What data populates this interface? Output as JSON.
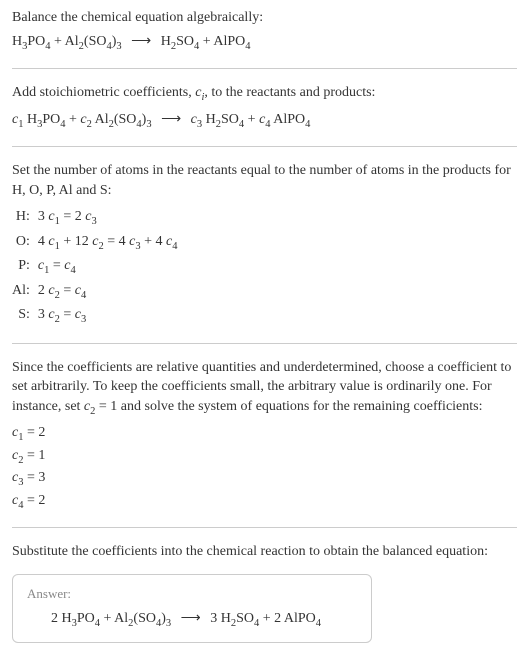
{
  "intro": {
    "line1": "Balance the chemical equation algebraically:",
    "eq_lhs1": "H",
    "eq_lhs1_sub": "3",
    "eq_lhs2": "PO",
    "eq_lhs2_sub": "4",
    "plus1": " + ",
    "eq_lhs3": "Al",
    "eq_lhs3_sub": "2",
    "eq_lhs4": "(SO",
    "eq_lhs4_sub": "4",
    "eq_lhs5": ")",
    "eq_lhs5_sub": "3",
    "arrow": "⟶",
    "eq_rhs1": "H",
    "eq_rhs1_sub": "2",
    "eq_rhs2": "SO",
    "eq_rhs2_sub": "4",
    "plus2": " + ",
    "eq_rhs3": "AlPO",
    "eq_rhs3_sub": "4"
  },
  "stoich": {
    "text": "Add stoichiometric coefficients, ",
    "ci": "c",
    "ci_sub": "i",
    "text2": ", to the reactants and products:",
    "c1": "c",
    "c1_sub": "1",
    "sp1": " H",
    "sp1a": "3",
    "sp1b": "PO",
    "sp1c": "4",
    "plus1": " + ",
    "c2": "c",
    "c2_sub": "2",
    "sp2": " Al",
    "sp2a": "2",
    "sp2b": "(SO",
    "sp2c": "4",
    "sp2d": ")",
    "sp2e": "3",
    "arrow": "⟶",
    "c3": "c",
    "c3_sub": "3",
    "sp3": " H",
    "sp3a": "2",
    "sp3b": "SO",
    "sp3c": "4",
    "plus2": " + ",
    "c4": "c",
    "c4_sub": "4",
    "sp4": " AlPO",
    "sp4a": "4"
  },
  "atoms": {
    "text": "Set the number of atoms in the reactants equal to the number of atoms in the products for H, O, P, Al and S:",
    "rows": [
      {
        "el": "H:",
        "lhs_a": "3 ",
        "lhs_c": "c",
        "lhs_s": "1",
        "mid": " = 2 ",
        "rhs_c": "c",
        "rhs_s": "3",
        "tail": ""
      },
      {
        "el": "O:",
        "lhs_a": "4 ",
        "lhs_c": "c",
        "lhs_s": "1",
        "mid": " + 12 ",
        "mid_c": "c",
        "mid_s": "2",
        "mid2": " = 4 ",
        "rhs_c": "c",
        "rhs_s": "3",
        "tail": " + 4 ",
        "tail_c": "c",
        "tail_s": "4"
      },
      {
        "el": "P:",
        "lhs_a": "",
        "lhs_c": "c",
        "lhs_s": "1",
        "mid": " = ",
        "rhs_c": "c",
        "rhs_s": "4",
        "tail": ""
      },
      {
        "el": "Al:",
        "lhs_a": "2 ",
        "lhs_c": "c",
        "lhs_s": "2",
        "mid": " = ",
        "rhs_c": "c",
        "rhs_s": "4",
        "tail": ""
      },
      {
        "el": "S:",
        "lhs_a": "3 ",
        "lhs_c": "c",
        "lhs_s": "2",
        "mid": " = ",
        "rhs_c": "c",
        "rhs_s": "3",
        "tail": ""
      }
    ]
  },
  "choose": {
    "text1": "Since the coefficients are relative quantities and underdetermined, choose a coefficient to set arbitrarily. To keep the coefficients small, the arbitrary value is ordinarily one. For instance, set ",
    "cv": "c",
    "cv_sub": "2",
    "text2": " = 1 and solve the system of equations for the remaining coefficients:",
    "coeffs": [
      {
        "c": "c",
        "s": "1",
        "eq": " = 2"
      },
      {
        "c": "c",
        "s": "2",
        "eq": " = 1"
      },
      {
        "c": "c",
        "s": "3",
        "eq": " = 3"
      },
      {
        "c": "c",
        "s": "4",
        "eq": " = 2"
      }
    ]
  },
  "subst": {
    "text": "Substitute the coefficients into the chemical reaction to obtain the balanced equation:"
  },
  "answer": {
    "label": "Answer:",
    "n1": "2 ",
    "r1a": "H",
    "r1as": "3",
    "r1b": "PO",
    "r1bs": "4",
    "plus1": " + ",
    "r2a": "Al",
    "r2as": "2",
    "r2b": "(SO",
    "r2bs": "4",
    "r2c": ")",
    "r2cs": "3",
    "arrow": "⟶",
    "n3": " 3 ",
    "p1a": "H",
    "p1as": "2",
    "p1b": "SO",
    "p1bs": "4",
    "plus2": " + ",
    "n4": "2 ",
    "p2a": "AlPO",
    "p2as": "4"
  }
}
